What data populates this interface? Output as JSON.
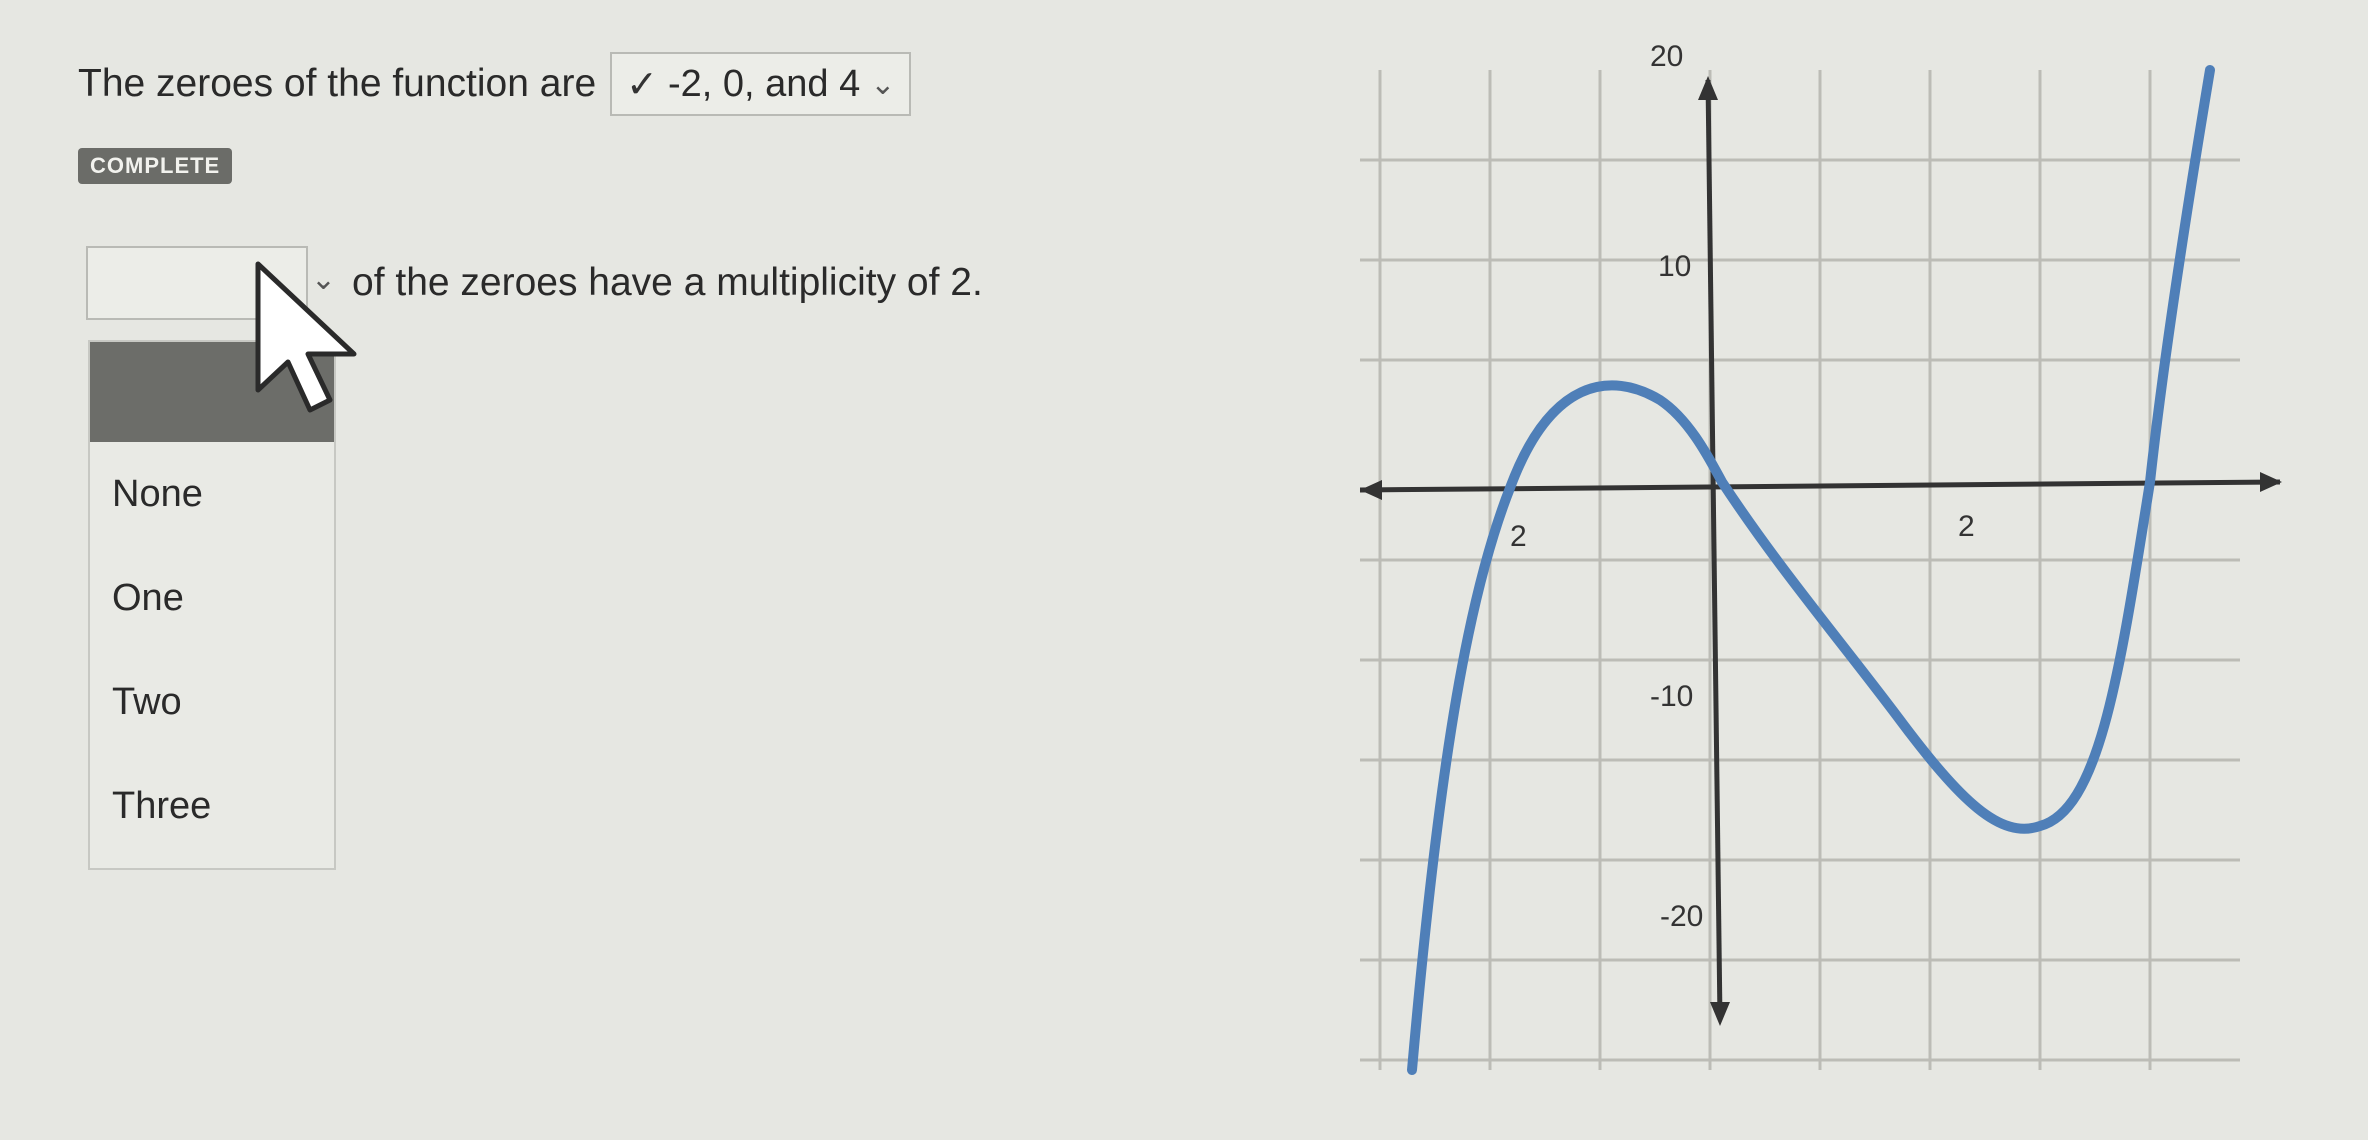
{
  "question1": {
    "prefix": "The zeroes of the function are",
    "answer": "-2, 0, and 4",
    "check_icon": "✓",
    "chevron_icon": "⌄"
  },
  "badge": "COMPLETE",
  "question2": {
    "text": "of the zeroes have a multiplicity of 2.",
    "chevron_icon": "⌄"
  },
  "dropdown": {
    "options": [
      "None",
      "One",
      "Two",
      "Three"
    ]
  },
  "graph": {
    "y_labels": [
      "20",
      "10",
      "-10",
      "-20"
    ],
    "x_labels": [
      "2",
      "2"
    ],
    "curve_color": "#4f7fb8",
    "grid_color": "#bcbcb6",
    "axis_color": "#333333"
  }
}
